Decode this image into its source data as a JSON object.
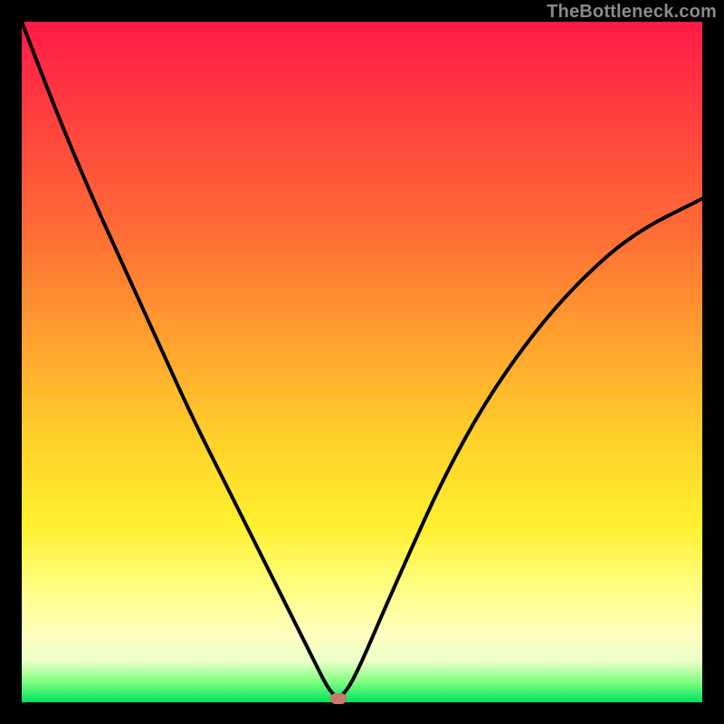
{
  "watermark": "TheBottleneck.com",
  "chart_data": {
    "type": "line",
    "title": "",
    "xlabel": "",
    "ylabel": "",
    "xlim": [
      0,
      100
    ],
    "ylim": [
      0,
      100
    ],
    "grid": false,
    "series": [
      {
        "name": "curve",
        "x": [
          0,
          5,
          10,
          15,
          20,
          25,
          30,
          35,
          40,
          43,
          45,
          46.5,
          48,
          50,
          53,
          57,
          62,
          68,
          75,
          82,
          90,
          100
        ],
        "values": [
          100,
          87,
          75,
          64,
          53,
          42,
          32,
          22,
          12,
          6,
          2,
          0.5,
          2,
          6,
          13,
          22,
          33,
          44,
          54,
          62,
          69,
          74
        ]
      }
    ],
    "marker": {
      "x": 46.5,
      "y": 0.5,
      "color": "#c77a6a"
    }
  },
  "colors": {
    "curve": "#000000",
    "marker": "#c77a6a",
    "frame": "#000000"
  }
}
